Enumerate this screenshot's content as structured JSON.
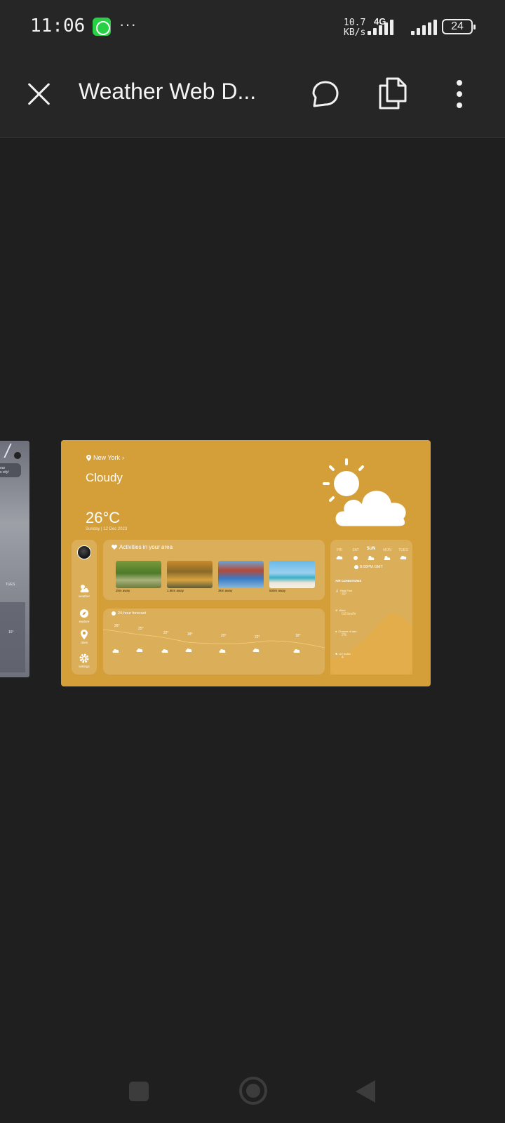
{
  "status_bar": {
    "time": "11:06",
    "more": "···",
    "net_speed_value": "10.7",
    "net_speed_unit": "KB/s",
    "net_type": "4G",
    "battery": "24",
    "icons": [
      "whatsapp-icon",
      "signal-icon",
      "battery-icon"
    ]
  },
  "app_bar": {
    "title": "Weather Web D...",
    "icons": [
      "close-icon",
      "comment-icon",
      "copy-icon",
      "more-vert-icon"
    ]
  },
  "preview": {
    "location": "New York",
    "condition": "Cloudy",
    "temperature": "26°C",
    "date": "Sunday | 12 Dec 2023",
    "sidebar": [
      {
        "label": "weather",
        "icon": "cloud-sun-icon"
      },
      {
        "label": "explore",
        "icon": "compass-icon"
      },
      {
        "label": "cities",
        "icon": "map-pin-icon"
      },
      {
        "label": "settings",
        "icon": "gear-icon"
      }
    ],
    "activities_title": "Activities in your area",
    "activities": [
      {
        "caption": "2km away",
        "icon": "park-photo"
      },
      {
        "caption": "1.5km away",
        "icon": "autumn-park-photo"
      },
      {
        "caption": "3km away",
        "icon": "waterpark-photo"
      },
      {
        "caption": "500m away",
        "icon": "beach-photo"
      }
    ],
    "forecast_title": "24-hour forecast",
    "forecast_temps": [
      "26°",
      "25°",
      "22°",
      "18°",
      "20°",
      "22°",
      "18°"
    ],
    "week": {
      "days": [
        "FRI",
        "SAT",
        "SUN",
        "MON",
        "TUES"
      ],
      "active_day": "SUN",
      "time": "8:00PM GMT"
    },
    "air_conditions": {
      "title": "AIR CONDITIONS",
      "items": [
        {
          "label": "Real Feel",
          "value": "30°"
        },
        {
          "label": "Wind",
          "value": "0.8 km/hr"
        },
        {
          "label": "Chance of rain",
          "value": "2%"
        },
        {
          "label": "UV Index",
          "value": "4"
        }
      ]
    },
    "previous_frame": {
      "visible_label": "TUES",
      "temp": "16°"
    }
  },
  "colors": {
    "frame_bg": "#d49e38",
    "canvas_bg": "#1f1f1f",
    "app_bar_bg": "#262626",
    "whatsapp": "#27d045"
  }
}
